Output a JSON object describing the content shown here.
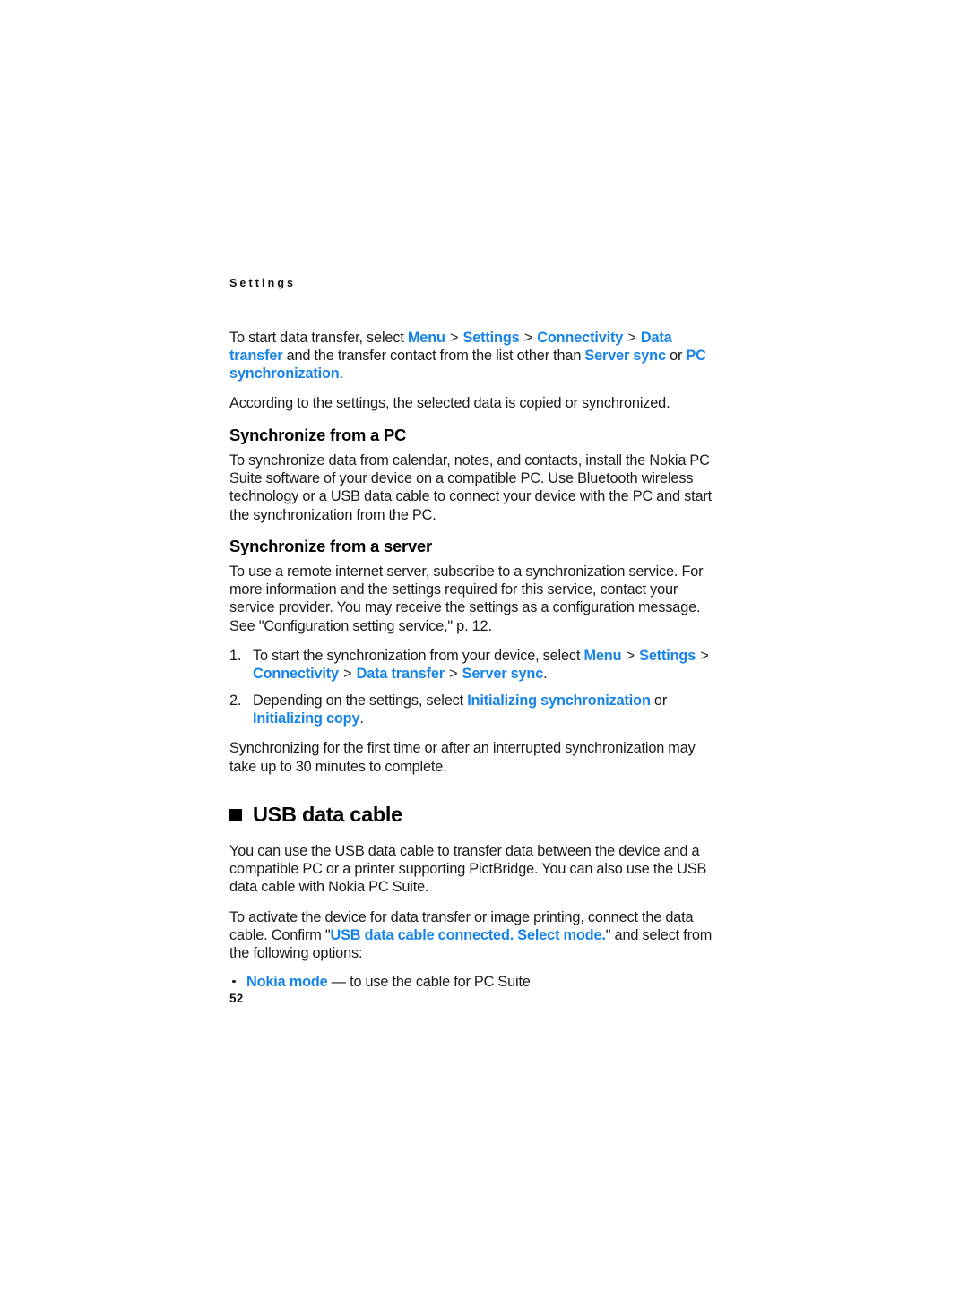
{
  "document": {
    "running_head": "Settings",
    "page_number": "52",
    "accent_color": "#1683e8",
    "text_color": "#1a1a1a",
    "background_color": "#ffffff"
  },
  "content": {
    "intro_paragraph": {
      "segments": [
        {
          "type": "text",
          "text": "To start data transfer, select "
        },
        {
          "type": "ui",
          "text": "Menu"
        },
        {
          "type": "sep",
          "text": " > "
        },
        {
          "type": "ui",
          "text": "Settings"
        },
        {
          "type": "sep",
          "text": " > "
        },
        {
          "type": "ui",
          "text": "Connectivity"
        },
        {
          "type": "sep",
          "text": " > "
        },
        {
          "type": "ui",
          "text": "Data transfer"
        },
        {
          "type": "text",
          "text": " and the transfer contact from the list other than "
        },
        {
          "type": "ui",
          "text": "Server sync"
        },
        {
          "type": "text",
          "text": " or "
        },
        {
          "type": "ui",
          "text": "PC synchronization"
        },
        {
          "type": "text",
          "text": "."
        }
      ],
      "plain": "To start data transfer, select Menu > Settings > Connectivity > Data transfer and the transfer contact from the list other than Server sync or PC synchronization."
    },
    "according_paragraph": "According to the settings, the selected data is copied or synchronized.",
    "sync_pc": {
      "heading": "Synchronize from a PC",
      "paragraph": "To synchronize data from calendar, notes, and contacts, install the Nokia PC Suite software of your device on a compatible PC. Use Bluetooth wireless technology or a USB data cable to connect your device with the PC and start the synchronization from the PC."
    },
    "sync_server": {
      "heading": "Synchronize from a server",
      "paragraph": "To use a remote internet server, subscribe to a synchronization service. For more information and the settings required for this service, contact your service provider. You may receive the settings as a configuration message. See \"Configuration setting service,\" p. 12.",
      "steps": [
        {
          "number": "1.",
          "segments": [
            {
              "type": "text",
              "text": "To start the synchronization from your device, select "
            },
            {
              "type": "ui",
              "text": "Menu"
            },
            {
              "type": "sep",
              "text": " > "
            },
            {
              "type": "ui",
              "text": "Settings"
            },
            {
              "type": "sep",
              "text": " > "
            },
            {
              "type": "ui",
              "text": "Connectivity"
            },
            {
              "type": "sep",
              "text": " > "
            },
            {
              "type": "ui",
              "text": "Data transfer"
            },
            {
              "type": "sep",
              "text": " > "
            },
            {
              "type": "ui",
              "text": "Server sync"
            },
            {
              "type": "text",
              "text": "."
            }
          ],
          "plain": "To start the synchronization from your device, select Menu > Settings > Connectivity > Data transfer > Server sync."
        },
        {
          "number": "2.",
          "segments": [
            {
              "type": "text",
              "text": "Depending on the settings, select "
            },
            {
              "type": "ui",
              "text": "Initializing synchronization"
            },
            {
              "type": "text",
              "text": " or "
            },
            {
              "type": "ui",
              "text": "Initializing copy"
            },
            {
              "type": "text",
              "text": "."
            }
          ],
          "plain": "Depending on the settings, select Initializing synchronization or Initializing copy."
        }
      ],
      "closing_paragraph": "Synchronizing for the first time or after an interrupted synchronization may take up to 30 minutes to complete."
    },
    "usb_data_cable": {
      "heading": "USB data cable",
      "paragraph_1": "You can use the USB data cable to transfer data between the device and a compatible PC or a printer supporting PictBridge. You can also use the USB data cable with Nokia PC Suite.",
      "paragraph_2": {
        "segments": [
          {
            "type": "text",
            "text": "To activate the device for data transfer or image printing, connect the data cable. Confirm \""
          },
          {
            "type": "ui",
            "text": "USB data cable connected. Select mode."
          },
          {
            "type": "text",
            "text": "\" and select from the following options:"
          }
        ],
        "plain": "To activate the device for data transfer or image printing, connect the data cable. Confirm \"USB data cable connected. Select mode.\" and select from the following options:"
      },
      "options": [
        {
          "segments": [
            {
              "type": "ui",
              "text": "Nokia mode"
            },
            {
              "type": "text",
              "text": " — to use the cable for PC Suite"
            }
          ],
          "plain": "Nokia mode — to use the cable for PC Suite"
        }
      ]
    }
  }
}
